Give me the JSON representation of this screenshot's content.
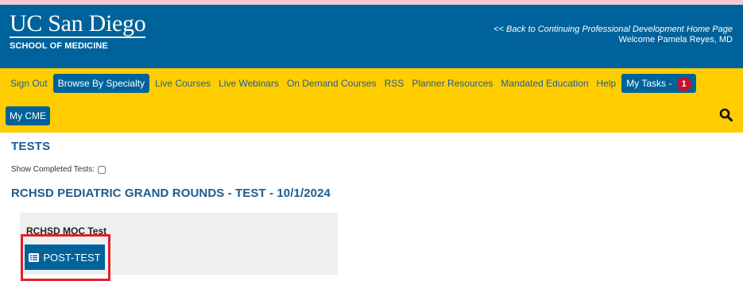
{
  "header": {
    "logo_main": "UC San Diego",
    "logo_sub": "SCHOOL OF MEDICINE",
    "back_link": "<< Back to Continuing Professional Development Home Page",
    "welcome": "Welcome Pamela Reyes, MD"
  },
  "nav": {
    "items": [
      {
        "label": "Sign Out"
      },
      {
        "label": "Browse By Specialty"
      },
      {
        "label": "Live Courses"
      },
      {
        "label": "Live Webinars"
      },
      {
        "label": "On Demand Courses"
      },
      {
        "label": "RSS"
      },
      {
        "label": "Planner Resources"
      },
      {
        "label": "Mandated Education"
      },
      {
        "label": "Help"
      },
      {
        "label": "My Tasks -"
      }
    ],
    "tasks_count": "1",
    "my_cme": "My CME",
    "search_icon": "search-icon"
  },
  "main": {
    "page_title": "TESTS",
    "show_completed_label": "Show Completed Tests:",
    "course_title": "RCHSD PEDIATRIC GRAND ROUNDS - TEST - 10/1/2024",
    "test_name": "RCHSD MOC Test",
    "post_test_label": "POST-TEST"
  },
  "colors": {
    "header_blue": "#00629b",
    "nav_gold": "#ffcd00",
    "badge_red": "#c8102e",
    "highlight_red": "#e0202a"
  }
}
